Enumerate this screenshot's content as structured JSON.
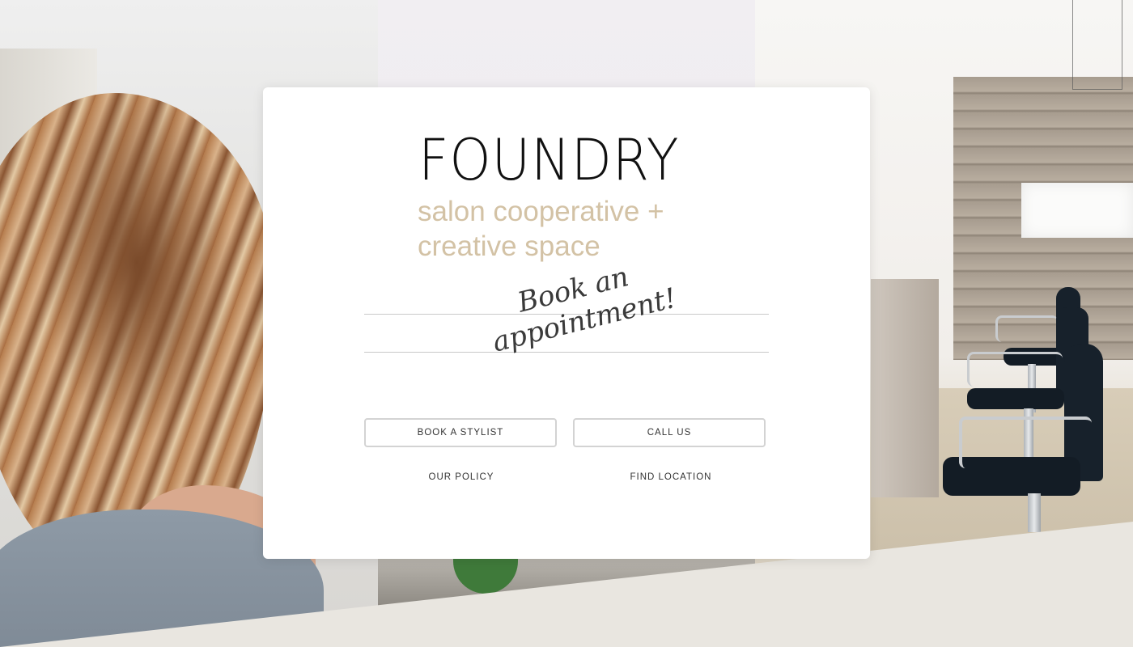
{
  "brand": {
    "name": "FOUNDRY",
    "tagline_line1": "salon cooperative +",
    "tagline_line2": "creative space"
  },
  "headline": {
    "line1": "Book an",
    "line2": "appointment!"
  },
  "actions": {
    "book_stylist": "BOOK A STYLIST",
    "call_us": "CALL US",
    "our_policy": "OUR POLICY",
    "find_location": "FIND LOCATION"
  },
  "colors": {
    "card_background": "#ffffff",
    "brand_text": "#111111",
    "tagline_text": "#d3c2a5",
    "button_border": "#d3d3d3",
    "page_bottom_band": "#e9e6e0"
  }
}
